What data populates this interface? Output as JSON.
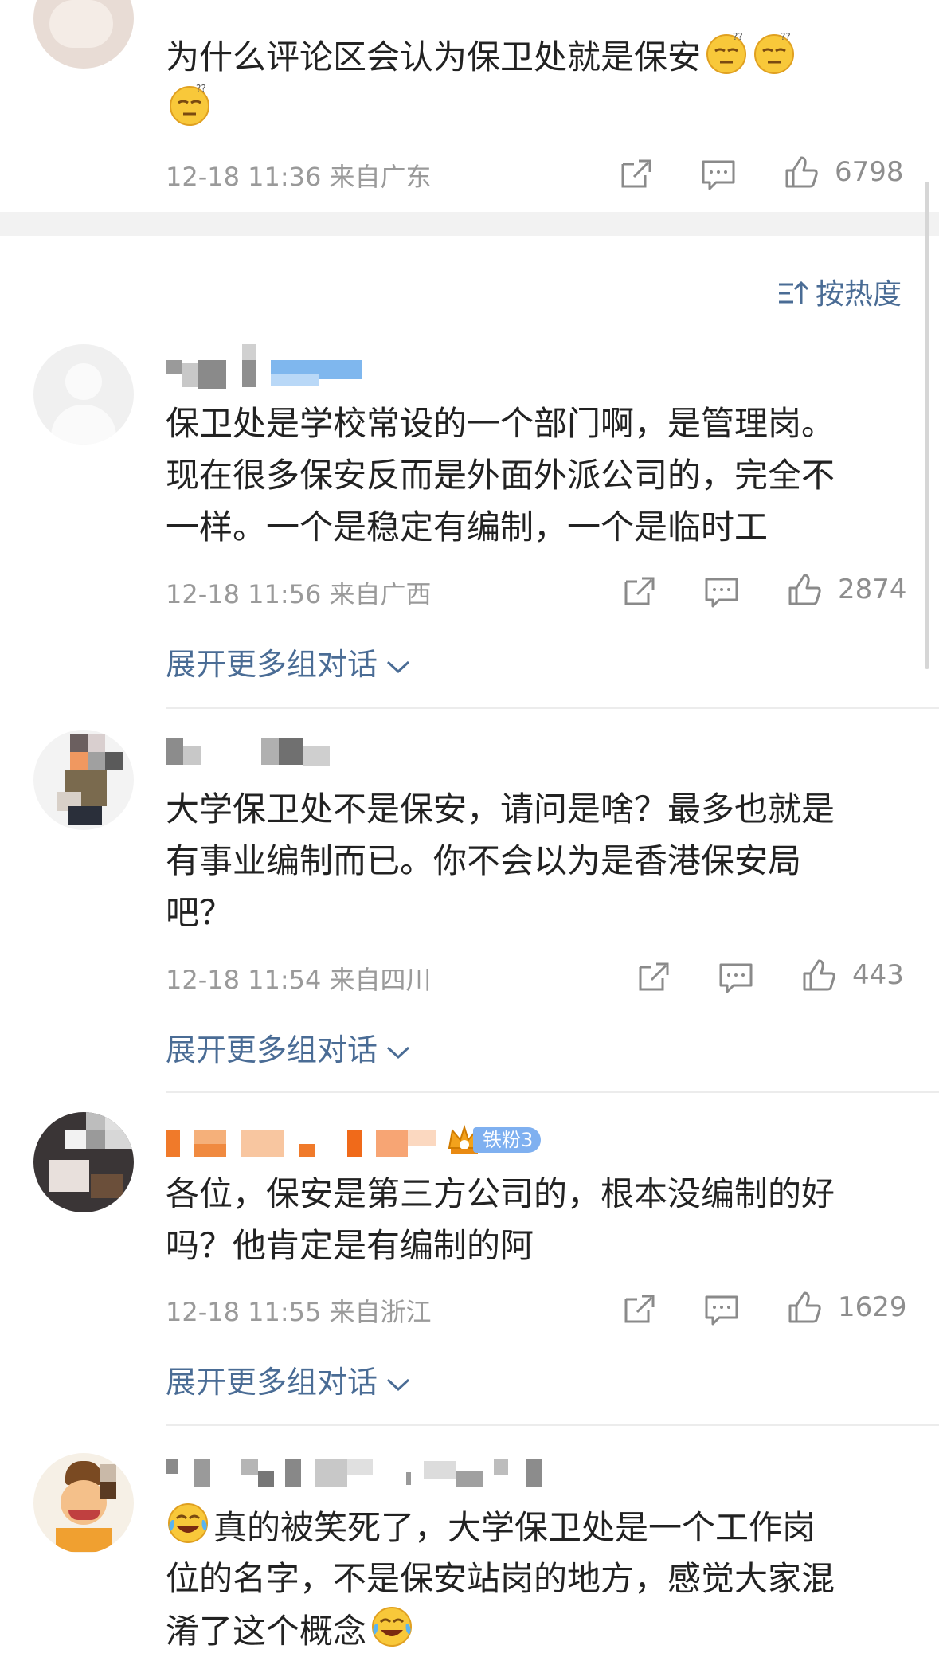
{
  "top_comment": {
    "text_line1": "为什么评论区会认为保卫处就是保安",
    "emoji": "sleepy-emoji",
    "meta": "12-18 11:36 来自广东",
    "likes": "6798"
  },
  "sort": {
    "label": "按热度"
  },
  "comments": [
    {
      "lines": [
        "保卫处是学校常设的一个部门啊，是管理岗。",
        "现在很多保安反而是外面外派公司的，完全不",
        "一样。一个是稳定有编制，一个是临时工"
      ],
      "meta": "12-18 11:56 来自广西",
      "likes": "2874",
      "expand": "展开更多组对话"
    },
    {
      "lines": [
        "大学保卫处不是保安，请问是啥？最多也就是",
        "有事业编制而已。你不会以为是香港保安局",
        "吧？"
      ],
      "meta": "12-18 11:54 来自四川",
      "likes": "443",
      "expand": "展开更多组对话"
    },
    {
      "badge": "铁粉3",
      "lines": [
        "各位，保安是第三方公司的，根本没编制的好",
        "吗？他肯定是有编制的阿"
      ],
      "meta": "12-18 11:55 来自浙江",
      "likes": "1629",
      "expand": "展开更多组对话"
    },
    {
      "lines": [
        "真的被笑死了，大学保卫处是一个工作岗",
        "位的名字，不是保安站岗的地方，感觉大家混",
        "淆了这个概念"
      ]
    }
  ],
  "colors": {
    "link": "#4a6c95",
    "meta": "#9a9a9a",
    "separator": "#f2f2f2"
  }
}
